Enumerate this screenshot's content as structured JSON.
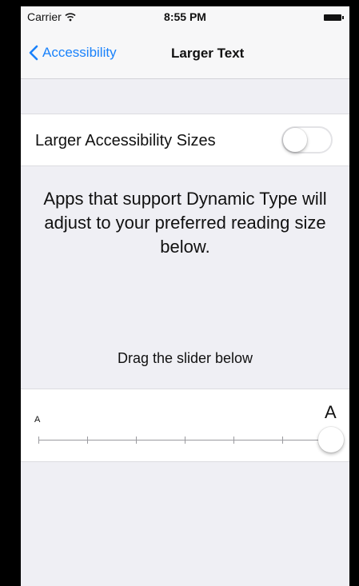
{
  "status_bar": {
    "carrier": "Carrier",
    "time": "8:55 PM"
  },
  "nav": {
    "back_label": "Accessibility",
    "title": "Larger Text"
  },
  "settings": {
    "larger_sizes_label": "Larger Accessibility Sizes",
    "larger_sizes_enabled": false
  },
  "description": "Apps that support Dynamic Type will adjust to your preferred reading size below.",
  "slider_hint": "Drag the slider below",
  "slider": {
    "min_label": "A",
    "max_label": "A",
    "steps": 7,
    "selected_step": 6
  },
  "colors": {
    "accent": "#1a82fb",
    "background": "#efeff4"
  },
  "icons": {
    "back": "chevron-left-icon",
    "wifi": "wifi-icon",
    "battery": "battery-icon"
  }
}
